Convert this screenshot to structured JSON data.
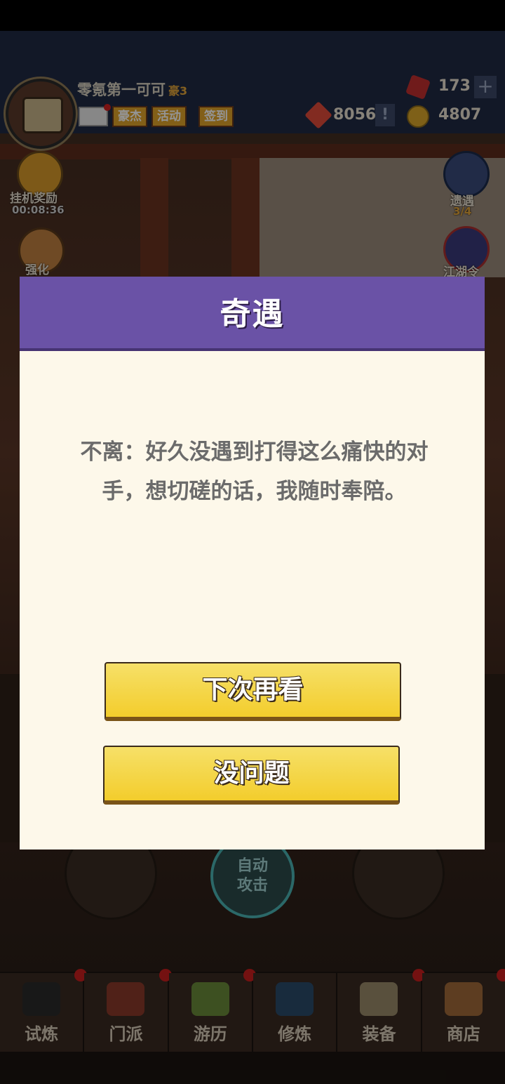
{
  "player": {
    "name": "零氪第一可可",
    "vip": "豪3",
    "avatar_icon": "treasure-chest-icon"
  },
  "header_tags": [
    "豪杰",
    "活动",
    "签到"
  ],
  "resources": {
    "gems": "173",
    "tokens": "8056",
    "coins": "4807"
  },
  "side_left": [
    {
      "label": "挂机奖励",
      "sub": "00:08:36",
      "icon": "chest-icon"
    },
    {
      "label": "强化",
      "icon": "ghost-icon"
    }
  ],
  "side_right": [
    {
      "label": "遗遇",
      "sub": "3/4",
      "icon": "ghost-icon"
    },
    {
      "label": "江湖令",
      "icon": "badge-icon"
    }
  ],
  "auto_attack": "自动\n攻击",
  "dialog": {
    "title": "奇遇",
    "message": "不离：好久没遇到打得这么痛快的对手，想切磋的话，我随时奉陪。",
    "btn_later": "下次再看",
    "btn_ok": "没问题"
  },
  "bottom_nav": [
    {
      "label": "试炼",
      "icon": "ninja-icon"
    },
    {
      "label": "门派",
      "icon": "temple-icon"
    },
    {
      "label": "游历",
      "icon": "mountain-icon"
    },
    {
      "label": "修炼",
      "icon": "book-icon"
    },
    {
      "label": "装备",
      "icon": "sword-icon"
    },
    {
      "label": "商店",
      "icon": "shop-icon"
    }
  ],
  "colors": {
    "dialog_header": "#6a52a6",
    "button_yellow": "#f3cd2c",
    "dialog_bg": "#fdf8ea"
  }
}
